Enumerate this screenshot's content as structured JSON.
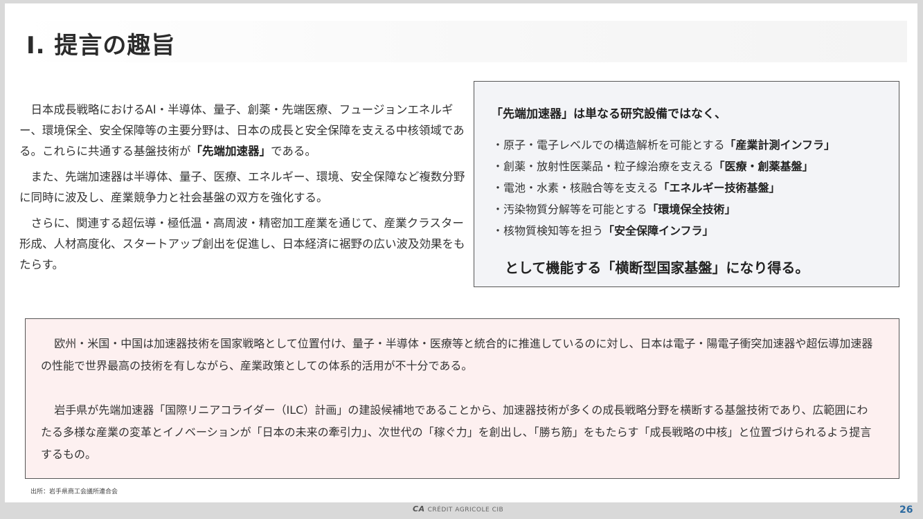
{
  "title": "I. 提言の趣旨",
  "left": {
    "p1_pre": "日本成長戦略におけるAI・半導体、量子、創薬・先端医療、フュージョンエネルギー、環境保全、安全保障等の主要分野は、日本の成長と安全保障を支える中核領域である。これらに共通する基盤技術が",
    "p1_bold": "「先端加速器」",
    "p1_post": "である。",
    "p2": "また、先端加速器は半導体、量子、医療、エネルギー、環境、安全保障など複数分野に同時に波及し、産業競争力と社会基盤の双方を強化する。",
    "p3": "さらに、関連する超伝導・極低温・高周波・精密加工産業を通じて、産業クラスター形成、人材高度化、スタートアップ創出を促進し、日本経済に裾野の広い波及効果をもたらす。"
  },
  "box": {
    "head": "「先端加速器」は単なる研究設備ではなく、",
    "items": [
      {
        "text": "・原子・電子レベルでの構造解析を可能とする",
        "bold": "「産業計測インフラ」"
      },
      {
        "text": "・創薬・放射性医薬品・粒子線治療を支える",
        "bold": "「医療・創薬基盤」"
      },
      {
        "text": "・電池・水素・核融合等を支える",
        "bold": "「エネルギー技術基盤」"
      },
      {
        "text": "・汚染物質分解等を可能とする",
        "bold": "「環境保全技術」"
      },
      {
        "text": "・核物質検知等を担う",
        "bold": "「安全保障インフラ」"
      }
    ],
    "foot": "として機能する「横断型国家基盤」になり得る。"
  },
  "bottom": {
    "p1": "欧州・米国・中国は加速器技術を国家戦略として位置付け、量子・半導体・医療等と統合的に推進しているのに対し、日本は電子・陽電子衝突加速器や超伝導加速器の性能で世界最高の技術を有しながら、産業政策としての体系的活用が不十分である。",
    "p2": "岩手県が先端加速器「国際リニアコライダー（ILC）計画」の建設候補地であることから、加速器技術が多くの成長戦略分野を横断する基盤技術であり、広範囲にわたる多様な産業の変革とイノベーションが「日本の未来の牽引力」、次世代の「稼ぐ力」を創出し、「勝ち筋」をもたらす「成長戦略の中核」と位置づけられるよう提言するもの。"
  },
  "source": "出所：岩手県商工会議所連合会",
  "footer": {
    "logo_mark": "CA",
    "logo_text": "CRÉDIT AGRICOLE CIB",
    "page_number": "26"
  }
}
